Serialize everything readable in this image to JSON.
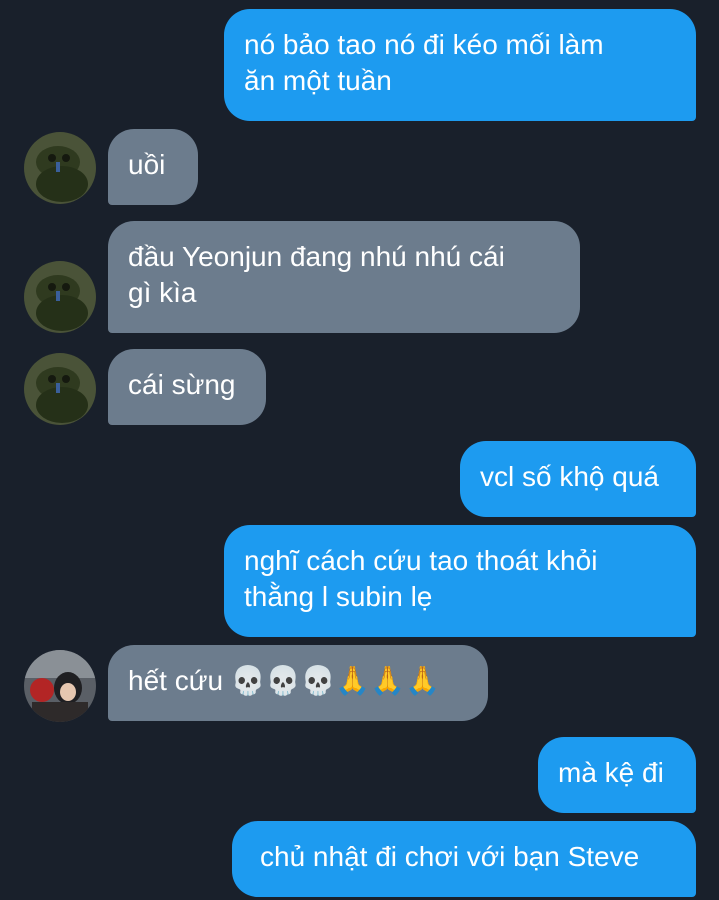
{
  "colors": {
    "background": "#19202b",
    "outgoing_bubble": "#1d9bf0",
    "incoming_bubble": "#6c7c8d",
    "text": "#ffffff"
  },
  "messages": [
    {
      "sender": "me",
      "text": "nó bảo tao nó đi kéo mối làm\năn một tuần"
    },
    {
      "sender": "them",
      "avatar": "frog-avatar",
      "text": "uồi"
    },
    {
      "sender": "them",
      "avatar": "frog-avatar",
      "text": "đầu Yeonjun đang nhú nhú cái\ngì kìa"
    },
    {
      "sender": "them",
      "avatar": "frog-avatar",
      "text": "cái sừng"
    },
    {
      "sender": "me",
      "text": "vcl số khộ quá"
    },
    {
      "sender": "me",
      "text": "nghĩ cách cứu tao thoát khỏi\nthằng l subin lẹ"
    },
    {
      "sender": "them",
      "avatar": "anime-avatar",
      "text": "hết cứu 💀💀💀🙏🙏🙏"
    },
    {
      "sender": "me",
      "text": "mà kệ đi"
    },
    {
      "sender": "me",
      "text": "chủ nhật đi chơi với bạn Steve"
    }
  ]
}
